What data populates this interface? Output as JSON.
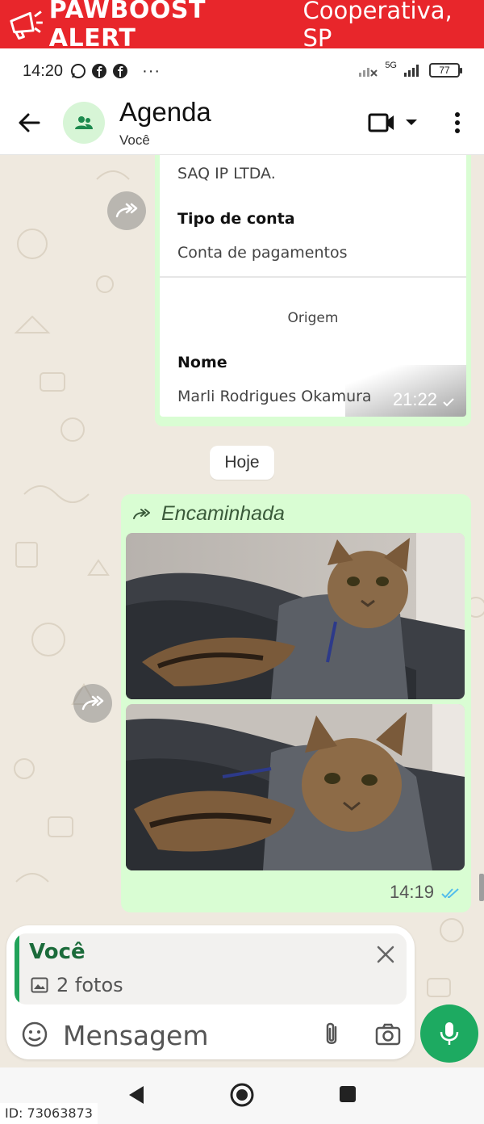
{
  "alert": {
    "brand": "PAWBOOST ALERT",
    "location": "Cooperativa, SP",
    "color": "#e8262b",
    "icon": "megaphone-icon"
  },
  "status_bar": {
    "time": "14:20",
    "icons": [
      "whatsapp-icon",
      "facebook-icon",
      "facebook-icon"
    ],
    "more": "···",
    "network": "5G",
    "battery": "77"
  },
  "header": {
    "title": "Agenda",
    "subtitle": "Você",
    "avatar_icon": "group-icon",
    "back_icon": "arrow-back-icon",
    "video_icon": "video-call-icon",
    "menu_icon": "more-vert-icon"
  },
  "messages": {
    "receipt": {
      "institution": "SAQ IP LTDA.",
      "account_type_label": "Tipo de conta",
      "account_type_value": "Conta de pagamentos",
      "section_title": "Origem",
      "name_label": "Nome",
      "name_value": "Marli Rodrigues Okamura",
      "time": "21:22",
      "status": "sent"
    },
    "day_separator": "Hoje",
    "photo_message": {
      "forwarded_label": "Encaminhada",
      "photo_count": 2,
      "time": "14:19",
      "status": "read"
    }
  },
  "composer": {
    "reply_to": "Você",
    "reply_preview": "2 fotos",
    "placeholder": "Mensagem",
    "accent": "#21a35a",
    "mic_color": "#1daa61"
  },
  "footer": {
    "id_label": "ID: 73063873"
  },
  "colors": {
    "outgoing_bubble": "#d9fdd3",
    "chat_background": "#efe9df",
    "read_ticks": "#53bdeb"
  }
}
